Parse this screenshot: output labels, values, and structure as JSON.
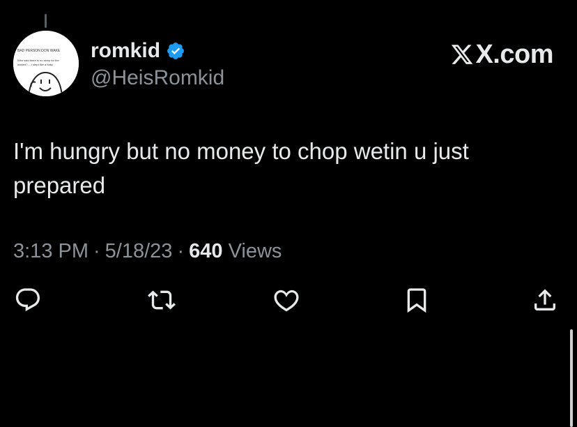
{
  "tweet": {
    "author": {
      "display_name": "romkid",
      "handle": "@HeisRomkid",
      "verified": true,
      "avatar": {
        "caption_title": "BAD PERSON DON WAKE",
        "caption_line1": "Who said there is no sleep for the",
        "caption_line2": "wicked?.....I slept like a baby"
      }
    },
    "brand": "X.com",
    "text": "I'm hungry but no money to chop wetin u just prepared",
    "meta": {
      "time": "3:13 PM",
      "separator": "·",
      "date": "5/18/23",
      "views_count": "640",
      "views_label": "Views"
    },
    "actions": [
      {
        "name": "reply",
        "icon": "reply-icon"
      },
      {
        "name": "retweet",
        "icon": "retweet-icon"
      },
      {
        "name": "like",
        "icon": "heart-icon"
      },
      {
        "name": "bookmark",
        "icon": "bookmark-icon"
      },
      {
        "name": "share",
        "icon": "share-icon"
      }
    ]
  },
  "colors": {
    "background": "#000000",
    "text_primary": "#e7e9ea",
    "text_secondary": "#8b9299",
    "verified_blue": "#1d9bf0"
  }
}
